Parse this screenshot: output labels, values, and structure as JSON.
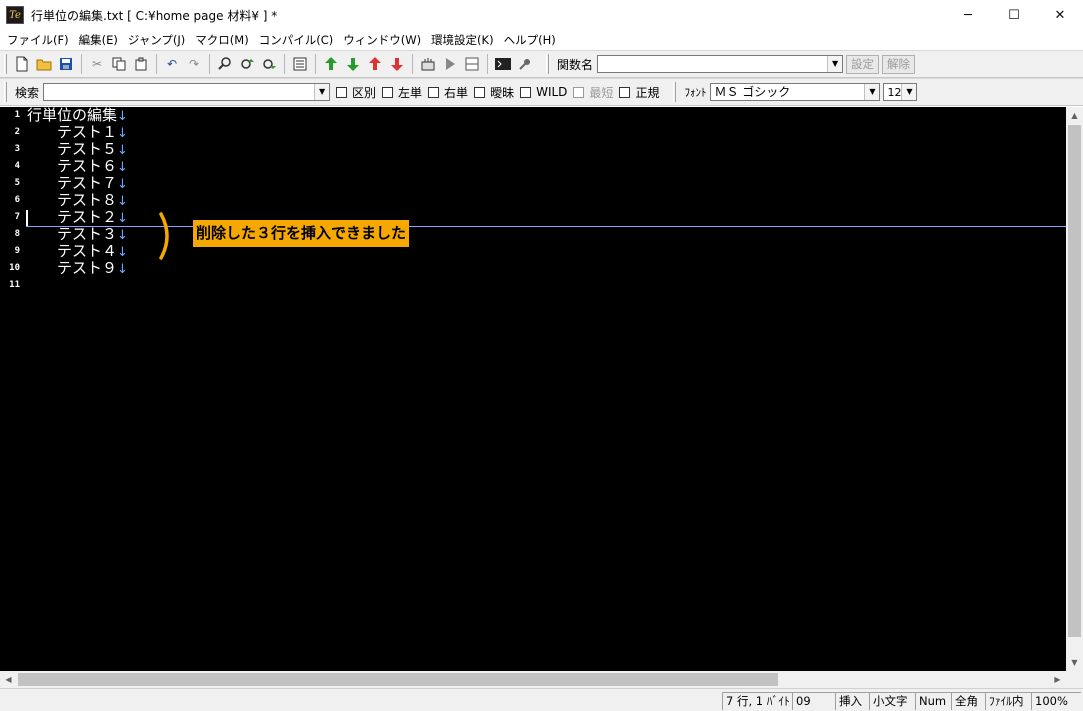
{
  "window": {
    "title": "行単位の編集.txt [ C:¥home page 材料¥ ] *",
    "app_icon": "Te",
    "minimize": "─",
    "maximize": "☐",
    "close": "✕"
  },
  "menu": [
    "ファイル(F)",
    "編集(E)",
    "ジャンプ(J)",
    "マクロ(M)",
    "コンパイル(C)",
    "ウィンドウ(W)",
    "環境設定(K)",
    "ヘルプ(H)"
  ],
  "toolbar1": {
    "func_label": "関数名",
    "func_value": "",
    "set_button": "設定",
    "clear_button": "解除"
  },
  "toolbar2": {
    "search_label": "検索",
    "search_value": "",
    "options": [
      {
        "label": "区別",
        "disabled": false
      },
      {
        "label": "左単",
        "disabled": false
      },
      {
        "label": "右単",
        "disabled": false
      },
      {
        "label": "曖昧",
        "disabled": false
      },
      {
        "label": "WILD",
        "disabled": false
      },
      {
        "label": "最短",
        "disabled": true
      },
      {
        "label": "正規",
        "disabled": false
      }
    ],
    "font_label": "ﾌｫﾝﾄ",
    "font_value": "ＭＳ ゴシック",
    "size_value": "12"
  },
  "editor": {
    "eol_mark": "↓",
    "lines": [
      {
        "num": "1",
        "text": "行単位の編集"
      },
      {
        "num": "2",
        "text": "　　テスト１"
      },
      {
        "num": "3",
        "text": "　　テスト５"
      },
      {
        "num": "4",
        "text": "　　テスト６"
      },
      {
        "num": "5",
        "text": "　　テスト７"
      },
      {
        "num": "6",
        "text": "　　テスト８"
      },
      {
        "num": "7",
        "text": "　　テスト２"
      },
      {
        "num": "8",
        "text": "　　テスト３"
      },
      {
        "num": "9",
        "text": "　　テスト４"
      },
      {
        "num": "10",
        "text": "　　テスト９"
      },
      {
        "num": "11",
        "text": ""
      }
    ],
    "current_line": 7
  },
  "annotation": {
    "text": "削除した３行を挿入できました",
    "color": "#f5a800"
  },
  "status": {
    "position": "7 行, 1 ﾊﾞｲﾄ",
    "code": "09",
    "mode": "挿入",
    "case": "小文字",
    "num": "Num",
    "width": "全角",
    "scope": "ﾌｧｲﾙ内",
    "zoom": "100%"
  }
}
